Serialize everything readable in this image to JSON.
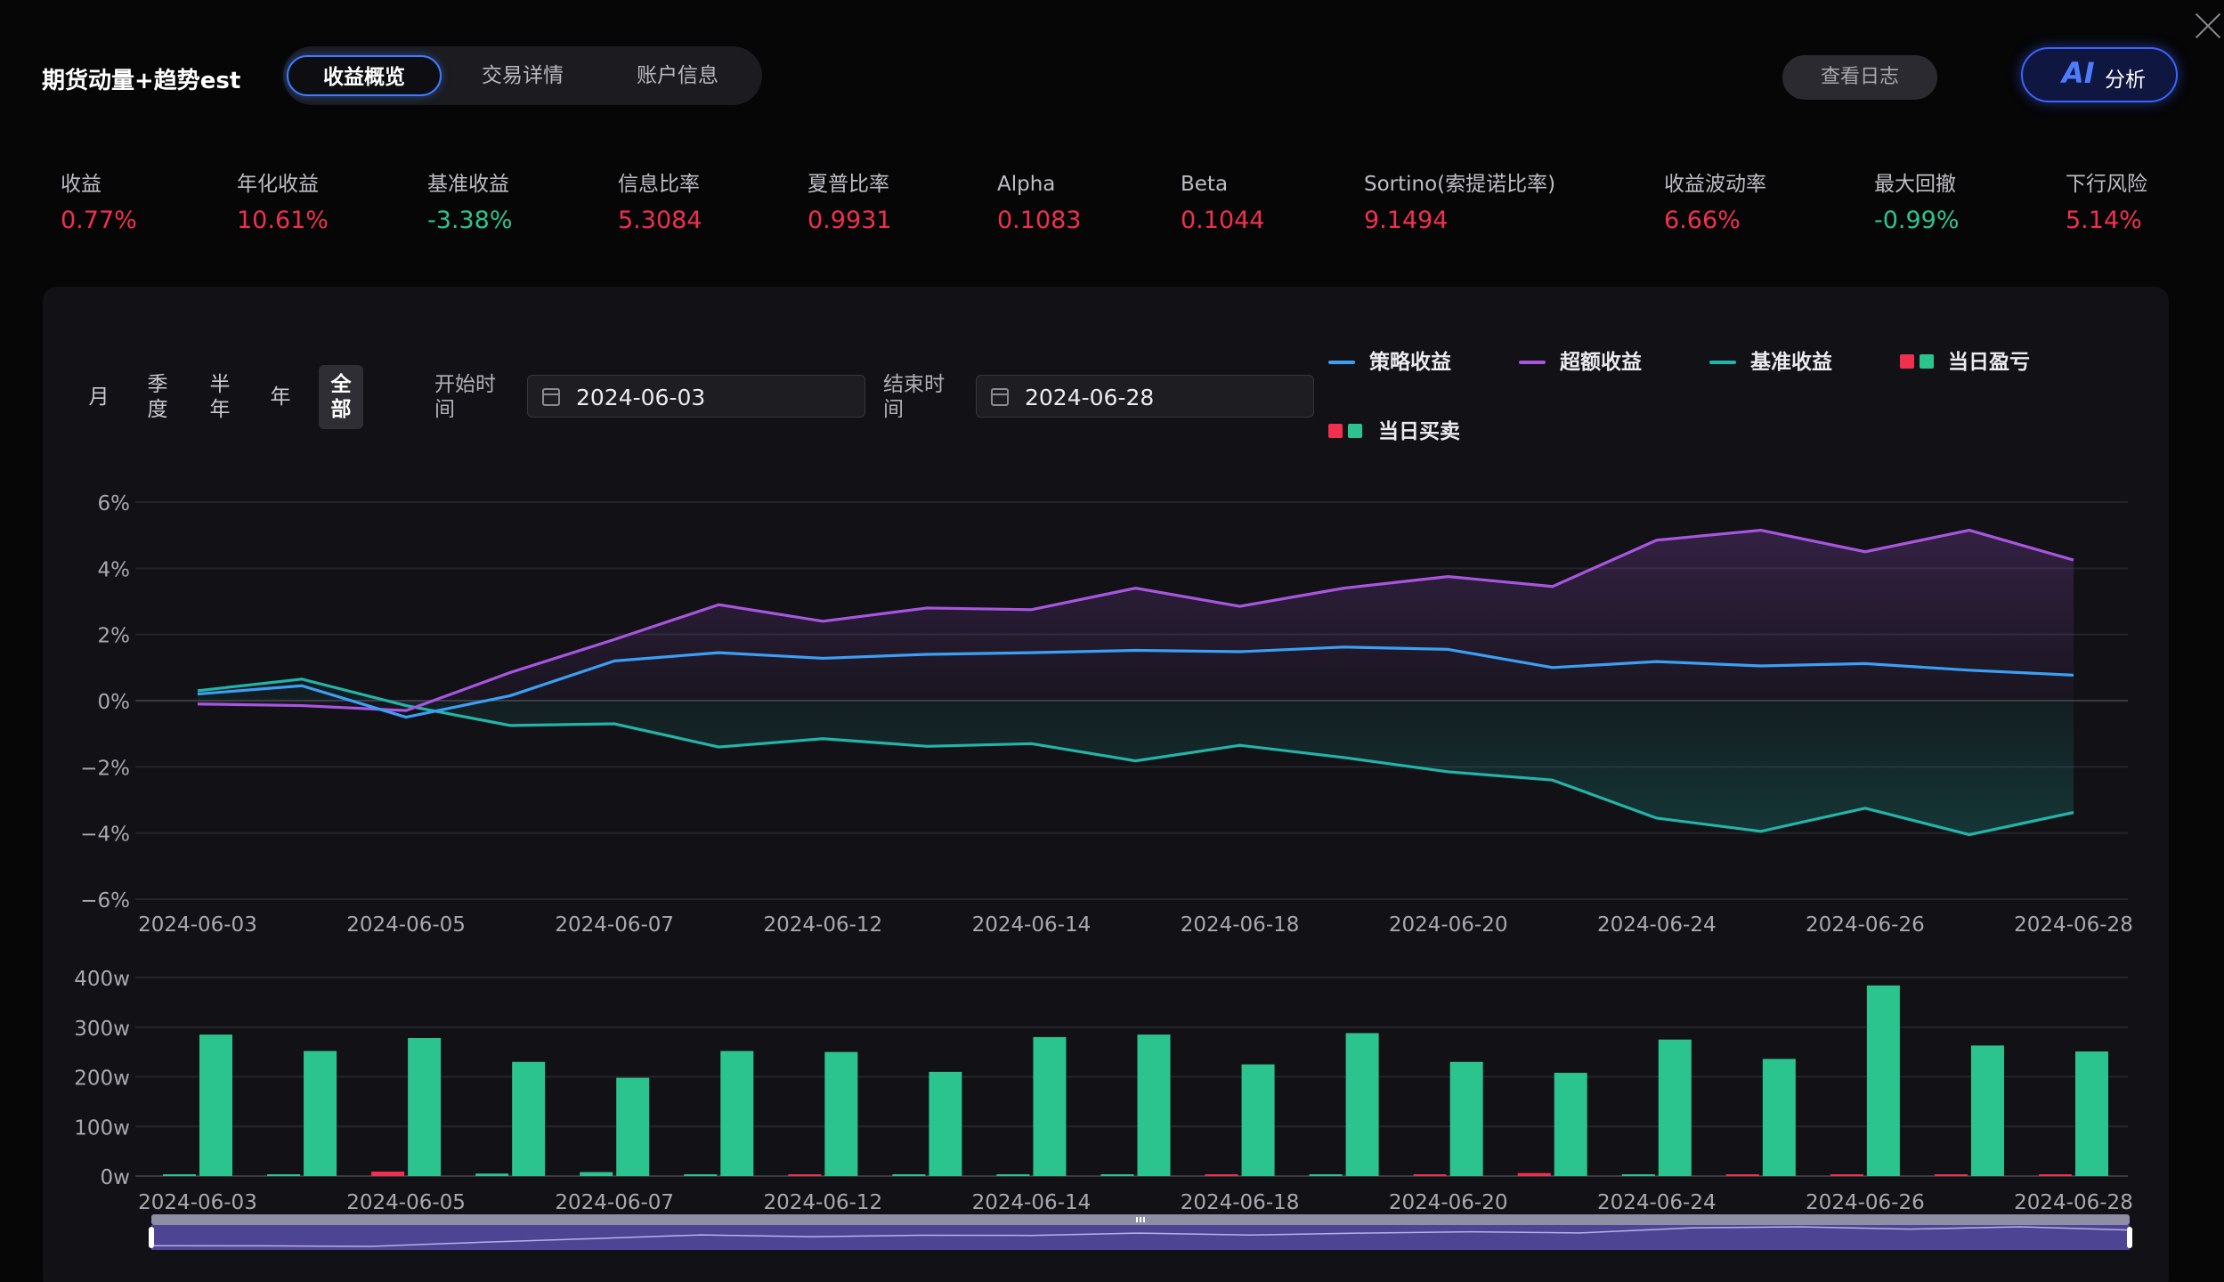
{
  "header": {
    "app_title": "期货动量+趋势est",
    "tabs": [
      {
        "label": "收益概览",
        "active": true
      },
      {
        "label": "交易详情",
        "active": false
      },
      {
        "label": "账户信息",
        "active": false
      }
    ],
    "log_button": "查看日志",
    "ai_button": {
      "icon": "AI",
      "label": "分析"
    }
  },
  "metrics": [
    {
      "label": "收益",
      "value": "0.77%",
      "tone": "pos"
    },
    {
      "label": "年化收益",
      "value": "10.61%",
      "tone": "pos"
    },
    {
      "label": "基准收益",
      "value": "-3.38%",
      "tone": "neg"
    },
    {
      "label": "信息比率",
      "value": "5.3084",
      "tone": "pos"
    },
    {
      "label": "夏普比率",
      "value": "0.9931",
      "tone": "pos"
    },
    {
      "label": "Alpha",
      "value": "0.1083",
      "tone": "pos"
    },
    {
      "label": "Beta",
      "value": "0.1044",
      "tone": "pos"
    },
    {
      "label": "Sortino(索提诺比率)",
      "value": "9.1494",
      "tone": "pos"
    },
    {
      "label": "收益波动率",
      "value": "6.66%",
      "tone": "pos"
    },
    {
      "label": "最大回撤",
      "value": "-0.99%",
      "tone": "neg"
    },
    {
      "label": "下行风险",
      "value": "5.14%",
      "tone": "pos"
    }
  ],
  "controls": {
    "ranges": [
      {
        "label": "月",
        "active": false
      },
      {
        "label": "季度",
        "active": false
      },
      {
        "label": "半年",
        "active": false
      },
      {
        "label": "年",
        "active": false
      },
      {
        "label": "全部",
        "active": true
      }
    ],
    "start_label": "开始时间",
    "start_date": "2024-06-03",
    "end_label": "结束时间",
    "end_date": "2024-06-28"
  },
  "colors": {
    "strategy": "#3b9ff5",
    "excess": "#a855e0",
    "benchmark": "#22b4a8",
    "profit_red": "#f0304e",
    "profit_green": "#2cc48e"
  },
  "chart_data": [
    {
      "type": "line",
      "x": [
        "2024-06-03",
        "2024-06-04",
        "2024-06-05",
        "2024-06-06",
        "2024-06-07",
        "2024-06-11",
        "2024-06-12",
        "2024-06-13",
        "2024-06-14",
        "2024-06-17",
        "2024-06-18",
        "2024-06-19",
        "2024-06-20",
        "2024-06-21",
        "2024-06-24",
        "2024-06-25",
        "2024-06-26",
        "2024-06-27",
        "2024-06-28"
      ],
      "x_tick_labels": [
        "2024-06-03",
        "2024-06-05",
        "2024-06-07",
        "2024-06-12",
        "2024-06-14",
        "2024-06-18",
        "2024-06-20",
        "2024-06-24",
        "2024-06-26",
        "2024-06-28"
      ],
      "y_ticks": [
        "6%",
        "4%",
        "2%",
        "0%",
        "−2%",
        "−4%",
        "−6%"
      ],
      "ylim": [
        -6,
        6
      ],
      "y_unit": "%",
      "grid": true,
      "legend_position": "top-right",
      "series": [
        {
          "name": "策略收益",
          "color": "#3b9ff5",
          "values": [
            0.2,
            0.45,
            -0.5,
            0.15,
            1.2,
            1.45,
            1.28,
            1.4,
            1.45,
            1.52,
            1.48,
            1.62,
            1.55,
            1.0,
            1.18,
            1.05,
            1.12,
            0.92,
            0.77
          ]
        },
        {
          "name": "超额收益",
          "color": "#a855e0",
          "values": [
            -0.1,
            -0.15,
            -0.3,
            0.85,
            1.85,
            2.9,
            2.4,
            2.8,
            2.75,
            3.4,
            2.85,
            3.4,
            3.75,
            3.45,
            4.85,
            5.15,
            4.5,
            5.15,
            4.25
          ]
        },
        {
          "name": "基准收益",
          "color": "#22b4a8",
          "values": [
            0.3,
            0.65,
            -0.15,
            -0.75,
            -0.7,
            -1.4,
            -1.15,
            -1.38,
            -1.3,
            -1.82,
            -1.35,
            -1.72,
            -2.15,
            -2.4,
            -3.55,
            -3.95,
            -3.25,
            -4.05,
            -3.38
          ]
        }
      ],
      "legend_extra": [
        "当日盈亏",
        "当日买卖"
      ]
    },
    {
      "type": "bar",
      "x": [
        "2024-06-03",
        "2024-06-04",
        "2024-06-05",
        "2024-06-06",
        "2024-06-07",
        "2024-06-11",
        "2024-06-12",
        "2024-06-13",
        "2024-06-14",
        "2024-06-17",
        "2024-06-18",
        "2024-06-19",
        "2024-06-20",
        "2024-06-21",
        "2024-06-24",
        "2024-06-25",
        "2024-06-26",
        "2024-06-27",
        "2024-06-28"
      ],
      "x_tick_labels": [
        "2024-06-03",
        "2024-06-05",
        "2024-06-07",
        "2024-06-12",
        "2024-06-14",
        "2024-06-18",
        "2024-06-20",
        "2024-06-24",
        "2024-06-26",
        "2024-06-28"
      ],
      "y_ticks": [
        "400w",
        "300w",
        "200w",
        "100w",
        "0w"
      ],
      "ylim": [
        0,
        400
      ],
      "y_unit": "w",
      "series": [
        {
          "name": "当日买卖",
          "color": "#2cc48e",
          "values": [
            285,
            252,
            278,
            230,
            198,
            252,
            250,
            210,
            280,
            285,
            225,
            288,
            230,
            208,
            275,
            236,
            384,
            263,
            251
          ]
        },
        {
          "name": "当日盈亏",
          "color_pos": "#f0304e",
          "color_neg": "#2cc48e",
          "values": [
            -2,
            -3,
            9,
            -5,
            -8,
            -2,
            2,
            -1,
            -1,
            -1,
            0,
            -1,
            1,
            6,
            -1,
            1,
            0,
            2,
            2
          ]
        }
      ]
    }
  ]
}
